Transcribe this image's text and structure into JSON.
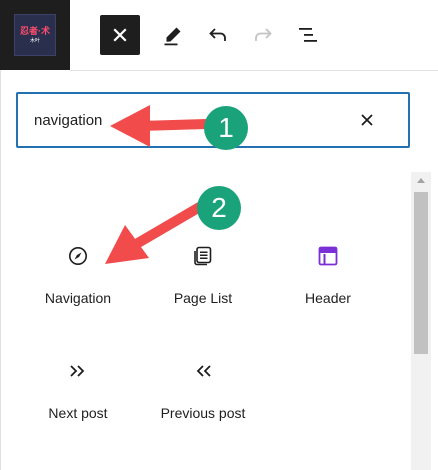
{
  "app": {
    "logo": {
      "mark": "忍者·术",
      "sub": "木叶"
    }
  },
  "toolbar": {
    "buttons": [
      {
        "name": "close-inserter",
        "icon": "close-icon"
      },
      {
        "name": "edit",
        "icon": "pencil-icon"
      },
      {
        "name": "undo",
        "icon": "undo-icon"
      },
      {
        "name": "redo",
        "icon": "redo-icon",
        "disabled": true
      },
      {
        "name": "document-overview",
        "icon": "list-view-icon"
      }
    ]
  },
  "search": {
    "value": "navigation",
    "clear_icon": "close-icon"
  },
  "blocks": [
    {
      "label": "Navigation",
      "icon": "compass-icon"
    },
    {
      "label": "Page List",
      "icon": "pages-icon"
    },
    {
      "label": "Header",
      "icon": "header-template-icon",
      "icon_color": "#7b2fd6"
    },
    {
      "label": "Next post",
      "icon": "double-chevron-right-icon"
    },
    {
      "label": "Previous post",
      "icon": "double-chevron-left-icon"
    }
  ],
  "annotations": {
    "badge1": "1",
    "badge2": "2",
    "arrow_color": "#f24b4b",
    "badge_color": "#1aa37a"
  }
}
